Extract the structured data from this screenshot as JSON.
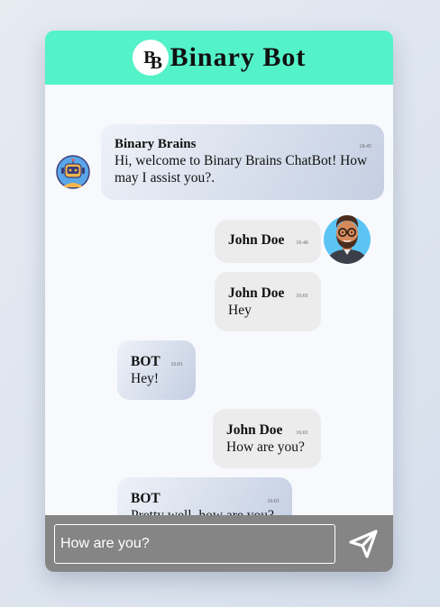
{
  "app": {
    "title": "Binary Bot",
    "logo_text": "BB"
  },
  "messages": [
    {
      "sender": "Binary Brains",
      "time": "18:45",
      "text": "Hi, welcome to Binary Brains ChatBot! How may I assist you?.",
      "side": "bot"
    },
    {
      "sender": "John Doe",
      "time": "16:46",
      "text": "",
      "side": "user"
    },
    {
      "sender": "John Doe",
      "time": "16:01",
      "text": "Hey",
      "side": "user"
    },
    {
      "sender": "BOT",
      "time": "16:01",
      "text": "Hey!",
      "side": "bot"
    },
    {
      "sender": "John Doe",
      "time": "16:01",
      "text": "How are you?",
      "side": "user"
    },
    {
      "sender": "BOT",
      "time": "16:01",
      "text": "Pretty well, how are you?",
      "side": "bot"
    }
  ],
  "composer": {
    "value": "How are you?",
    "send_icon": "paper-plane-icon"
  },
  "icons": {
    "bot_avatar": "robot-avatar-icon",
    "user_avatar": "user-avatar"
  },
  "colors": {
    "header": "#54f2c8",
    "composer": "#858585",
    "bot_bubble_end": "#c4cfe2",
    "user_bubble": "#ececec"
  }
}
